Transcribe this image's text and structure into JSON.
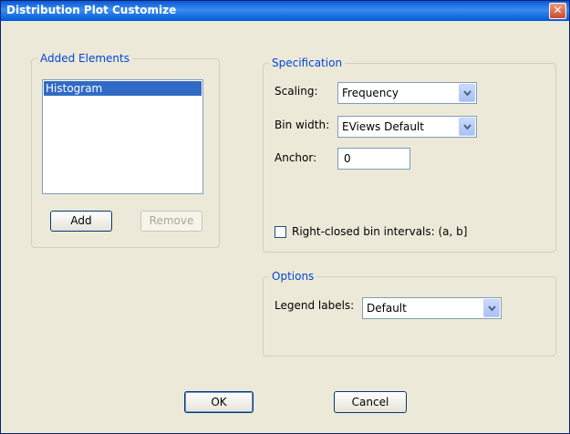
{
  "window": {
    "title": "Distribution Plot Customize",
    "close_glyph": "✕"
  },
  "added_elements": {
    "legend": "Added Elements",
    "items": [
      "Histogram"
    ],
    "add_label": "Add",
    "remove_label": "Remove"
  },
  "specification": {
    "legend": "Specification",
    "scaling_label": "Scaling:",
    "scaling_value": "Frequency",
    "bin_width_label": "Bin width:",
    "bin_width_value": "EViews Default",
    "anchor_label": "Anchor:",
    "anchor_value": "0",
    "right_closed_label": "Right-closed bin intervals: (a, b]",
    "right_closed_checked": false
  },
  "options": {
    "legend": "Options",
    "legend_labels_label": "Legend labels:",
    "legend_labels_value": "Default"
  },
  "footer": {
    "ok_label": "OK",
    "cancel_label": "Cancel"
  },
  "icons": {
    "close": "close-icon",
    "dropdown": "chevron-down-icon"
  }
}
